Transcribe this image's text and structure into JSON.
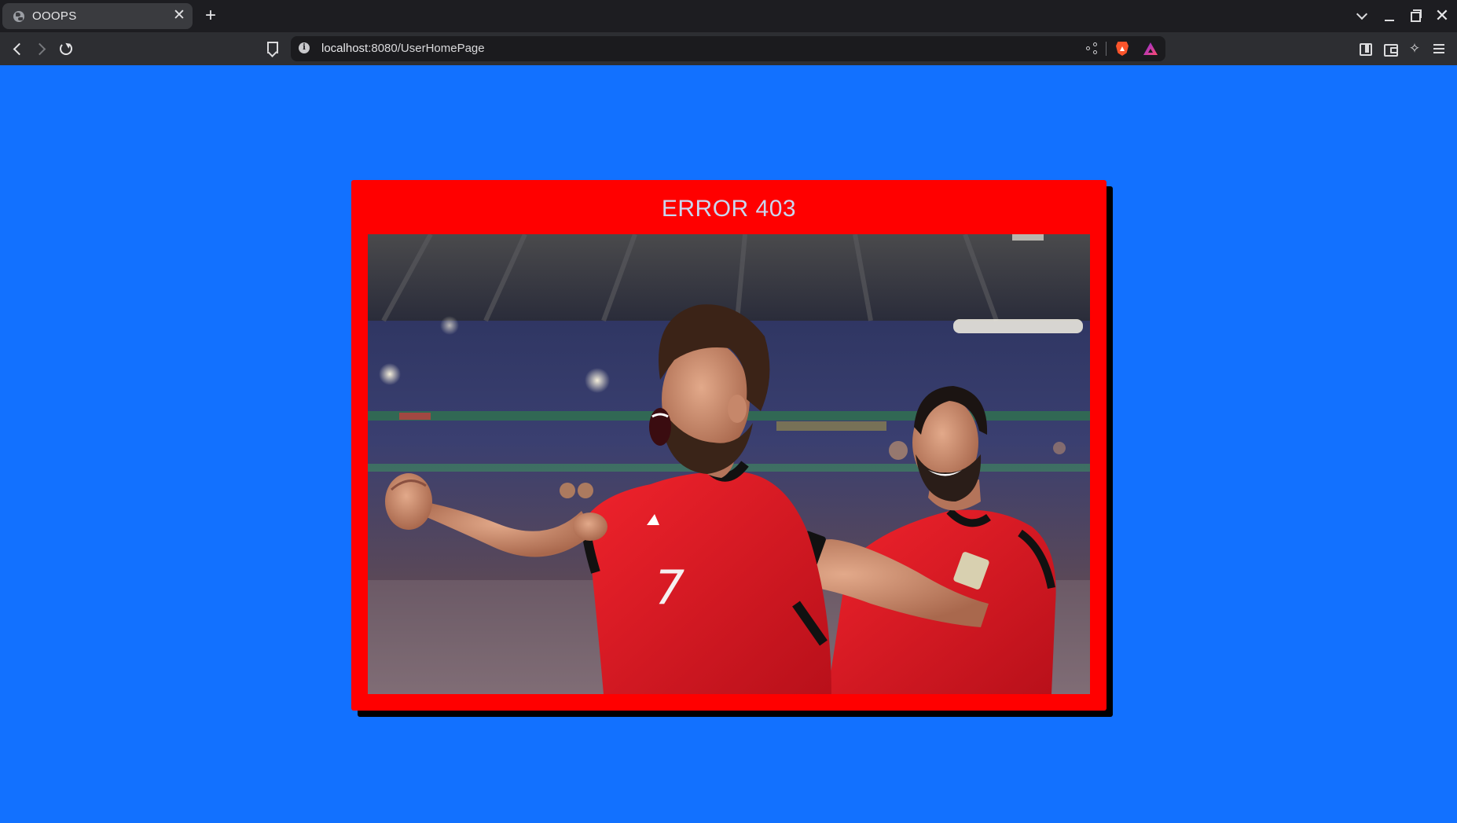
{
  "browser": {
    "tab": {
      "title": "OOOPS",
      "close_label": "✕"
    },
    "new_tab_label": "+",
    "url": {
      "host": "localhost",
      "path": ":8080/UserHomePage"
    },
    "window_controls": {
      "close_label": "✕"
    },
    "icons": {
      "tab_favicon": "globe-icon",
      "bookmark": "bookmark-icon",
      "site_info": "info-icon",
      "share": "share-icon",
      "shields": "brave-shields-icon",
      "rewards": "brave-rewards-icon",
      "sidebar": "sidebar-icon",
      "wallet": "wallet-icon",
      "leo": "leo-ai-icon",
      "menu": "hamburger-menu-icon"
    },
    "colors": {
      "tabbar": "#1d1d21",
      "toolbar": "#2d2e32",
      "urlbar": "#1b1b1e"
    }
  },
  "page": {
    "background_color": "#1271ff",
    "card": {
      "title": "ERROR 403",
      "background_color": "#ff0000",
      "title_color": "#c9d6ee"
    },
    "photo": {
      "subject": "two football players in red jerseys celebrating in a stadium",
      "jersey_number": "7"
    }
  }
}
